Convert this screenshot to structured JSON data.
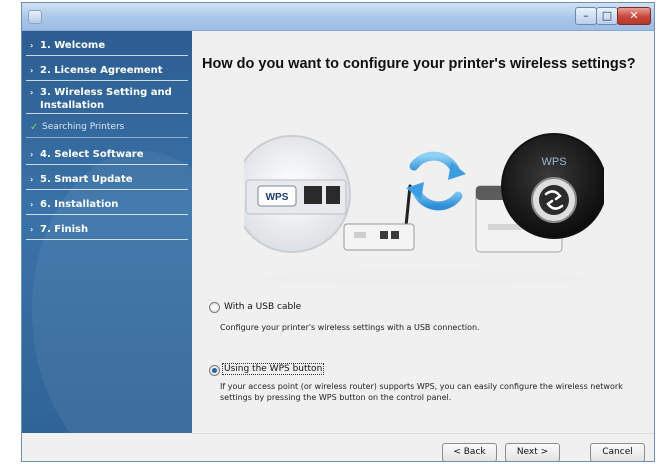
{
  "sidebar": {
    "steps": [
      {
        "label": "1. Welcome"
      },
      {
        "label": "2. License Agreement"
      },
      {
        "label": "3. Wireless Setting and Installation"
      },
      {
        "label": "Searching Printers"
      },
      {
        "label": "4. Select Software"
      },
      {
        "label": "5. Smart Update"
      },
      {
        "label": "6. Installation"
      },
      {
        "label": "7. Finish"
      }
    ]
  },
  "main": {
    "heading": "How do you want to configure your printer's wireless settings?",
    "illustration": {
      "router_badge": "WPS",
      "printer_badge": "WPS"
    },
    "options": [
      {
        "label": "With a USB cable",
        "description": "Configure your printer's wireless settings with a USB connection.",
        "selected": false
      },
      {
        "label": "Using the WPS button",
        "description": "If your access point (or wireless router) supports WPS, you can easily configure the wireless network settings by pressing the WPS button on the control panel.",
        "selected": true
      }
    ]
  },
  "footer": {
    "back_label": "< Back",
    "next_label": "Next >",
    "cancel_label": "Cancel"
  },
  "window": {
    "minimize_glyph": "–",
    "maximize_glyph": "□",
    "close_glyph": "✕"
  },
  "colors": {
    "sidebar": "#2d5d90",
    "accent": "#2b61a8",
    "close": "#c8453a"
  }
}
